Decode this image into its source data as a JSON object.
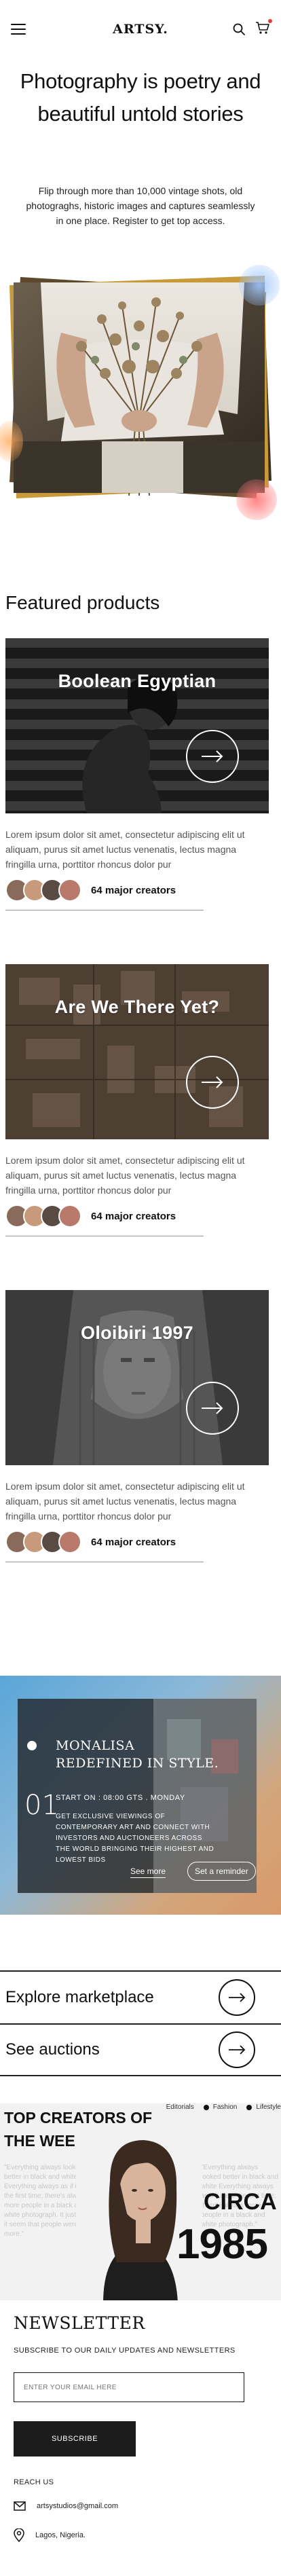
{
  "header": {
    "logo": "ARTSY.",
    "icons": [
      "menu-icon",
      "search-icon",
      "cart-icon"
    ]
  },
  "hero": {
    "title": "Photography is poetry and beautiful untold stories",
    "subtitle": "Flip through more than 10,000 vintage shots, old photograghs, historic images and captures seamlessly in one place. Register to get top access."
  },
  "featured": {
    "title": "Featured products",
    "products": [
      {
        "name": "Boolean Egyptian",
        "description": "Lorem ipsum dolor sit amet, consectetur adipiscing elit ut aliquam, purus sit amet luctus venenatis, lectus magna fringilla urna, porttitor rhoncus dolor pur",
        "creators": "64 major creators"
      },
      {
        "name": "Are We There Yet?",
        "description": "Lorem ipsum dolor sit amet, consectetur adipiscing elit ut aliquam, purus sit amet luctus venenatis, lectus magna fringilla urna, porttitor rhoncus dolor pur",
        "creators": "64 major creators"
      },
      {
        "name": "Oloibiri 1997",
        "description": "Lorem ipsum dolor sit amet, consectetur adipiscing elit ut aliquam, purus sit amet luctus venenatis, lectus magna fringilla urna, porttitor rhoncus dolor pur",
        "creators": "64 major creators"
      }
    ]
  },
  "promo": {
    "title": "MONALISA REDEFINED IN STYLE.",
    "number": "01",
    "start": "START ON : 08:00 GTS . MONDAY",
    "body": "GET EXCLUSIVE VIEWINGS OF CONTEMPORARY ART AND CONNECT WITH INVESTORS AND AUCTIONEERS ACROSS THE WORLD BRINGING THEIR HIGHEST AND LOWEST BIDS",
    "see_more": "See more",
    "reminder": "Set a reminder"
  },
  "links": {
    "marketplace": "Explore marketplace",
    "auctions": "See auctions"
  },
  "top_creators": {
    "title": "TOP CREATORS OF THE WEEK",
    "tags": [
      "Editorials",
      "Fashion",
      "Lifestyle"
    ],
    "faded_left": "\"Everything always looked better in black and white Everything always as if it were the first time; there's always more people in a black and white photograph. It just makes it seem that people were in it more.\"",
    "faded_right": "\"Everything always looked better in black and white Everything always as if it were the first time; there's always more people in a black and white photograph.\"",
    "circa": "CIRCA",
    "year": "1985"
  },
  "newsletter": {
    "title": "NEWSLETTER",
    "subtitle": "SUBSCRIBE TO OUR DAILY UPDATES AND NEWSLETTERS",
    "placeholder": "ENTER YOUR EMAIL HERE",
    "button": "SUBSCRIBE"
  },
  "contact": {
    "reach": "REACH US",
    "email": "artsystudios@gmail.com",
    "location": "Lagos, Nigeria."
  }
}
